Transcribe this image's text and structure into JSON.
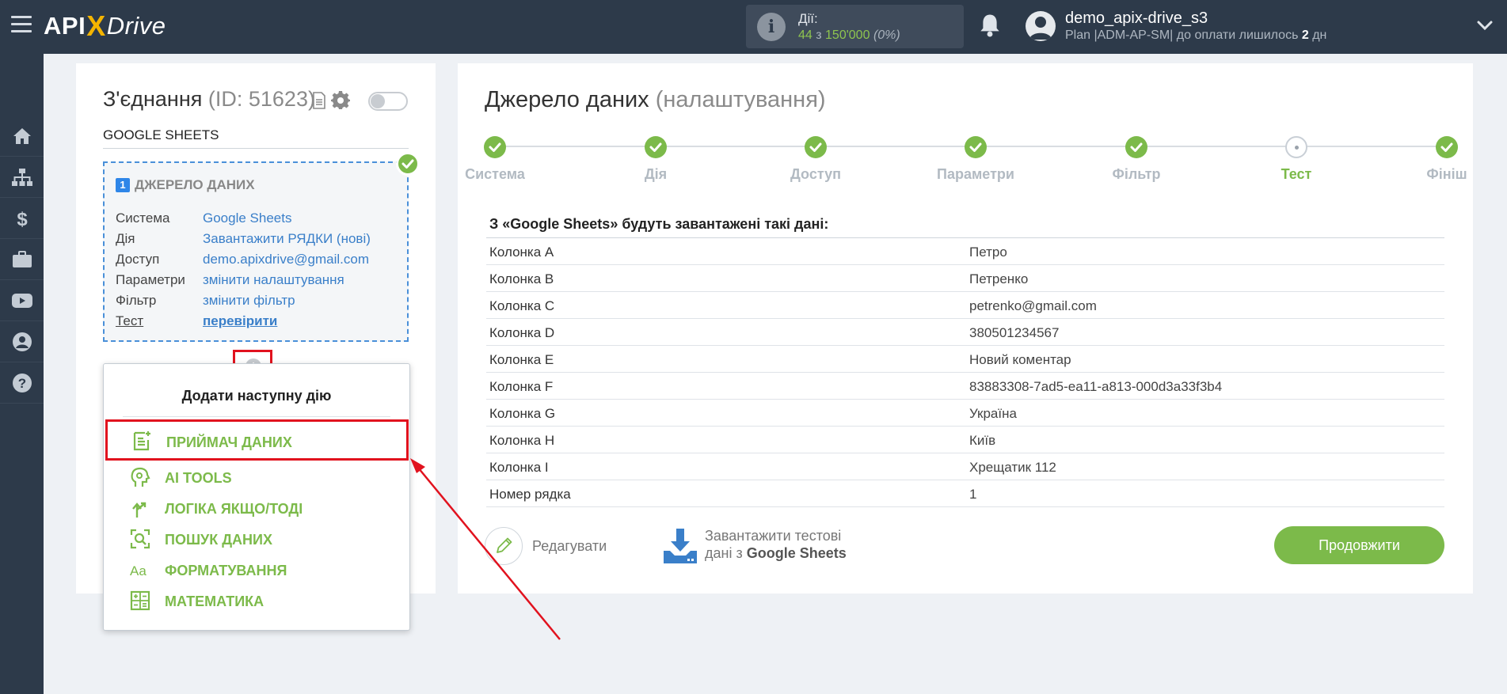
{
  "header": {
    "logo_part1": "API",
    "logo_x": "X",
    "logo_part2": "Drive",
    "actions_label": "Дії:",
    "actions_used": "44",
    "actions_sep": " з ",
    "actions_total": "150'000",
    "actions_pct": "(0%)",
    "user_name": "demo_apix-drive_s3",
    "plan_prefix": "Plan |ADM-AP-SM| до оплати лишилось ",
    "plan_days": "2",
    "plan_suffix": " дн"
  },
  "sidebar": {
    "items": [
      "home-icon",
      "sitemap-icon",
      "dollar-icon",
      "briefcase-icon",
      "youtube-icon",
      "user-icon",
      "help-icon"
    ]
  },
  "connection": {
    "title": "З'єднання",
    "id_text": "(ID: 51623)",
    "name": "GOOGLE SHEETS",
    "source": {
      "number": "1",
      "header": "ДЖЕРЕЛО ДАНИХ",
      "rows": [
        {
          "key": "Система",
          "value": "Google Sheets"
        },
        {
          "key": "Дія",
          "value": "Завантажити РЯДКИ (нові)"
        },
        {
          "key": "Доступ",
          "value": "demo.apixdrive@gmail.com"
        },
        {
          "key": "Параметри",
          "value": "змінити налаштування"
        },
        {
          "key": "Фільтр",
          "value": "змінити фільтр"
        },
        {
          "key": "Тест",
          "value": "перевірити"
        }
      ]
    },
    "plus_symbol": "+"
  },
  "menu": {
    "title": "Додати наступну дію",
    "items": [
      {
        "label": "ПРИЙМАЧ ДАНИХ",
        "icon": "receiver-icon"
      },
      {
        "label": "AI TOOLS",
        "icon": "ai-tools-icon"
      },
      {
        "label": "ЛОГІКА ЯКЩО/ТОДІ",
        "icon": "logic-icon"
      },
      {
        "label": "ПОШУК ДАНИХ",
        "icon": "search-data-icon"
      },
      {
        "label": "ФОРМАТУВАННЯ",
        "icon": "format-icon"
      },
      {
        "label": "МАТЕМАТИКА",
        "icon": "math-icon"
      }
    ]
  },
  "source_settings": {
    "title": "Джерело даних",
    "subtitle": "(налаштування)",
    "steps": [
      {
        "label": "Система",
        "state": "done"
      },
      {
        "label": "Дія",
        "state": "done"
      },
      {
        "label": "Доступ",
        "state": "done"
      },
      {
        "label": "Параметри",
        "state": "done"
      },
      {
        "label": "Фільтр",
        "state": "done"
      },
      {
        "label": "Тест",
        "state": "current"
      },
      {
        "label": "Фініш",
        "state": "done"
      }
    ],
    "data_title": "З «Google Sheets» будуть завантажені такі дані:",
    "rows": [
      {
        "column": "Колонка A",
        "value": "Петро"
      },
      {
        "column": "Колонка B",
        "value": "Петренко"
      },
      {
        "column": "Колонка C",
        "value": "petrenko@gmail.com"
      },
      {
        "column": "Колонка D",
        "value": "380501234567"
      },
      {
        "column": "Колонка E",
        "value": "Новий коментар"
      },
      {
        "column": "Колонка F",
        "value": "83883308-7ad5-ea11-a813-000d3a33f3b4"
      },
      {
        "column": "Колонка G",
        "value": "Україна"
      },
      {
        "column": "Колонка H",
        "value": "Київ"
      },
      {
        "column": "Колонка I",
        "value": "Хрещатик 112"
      },
      {
        "column": "Номер рядка",
        "value": "1"
      }
    ],
    "edit_label": "Редагувати",
    "download_line1": "Завантажити тестові",
    "download_line2_prefix": "дані з ",
    "download_line2_bold": "Google Sheets",
    "continue_label": "Продовжити"
  },
  "colors": {
    "topbar": "#2d3a4a",
    "accent_green": "#7cba4a",
    "link_blue": "#3a7fc9",
    "highlight_red": "#e1121e"
  }
}
